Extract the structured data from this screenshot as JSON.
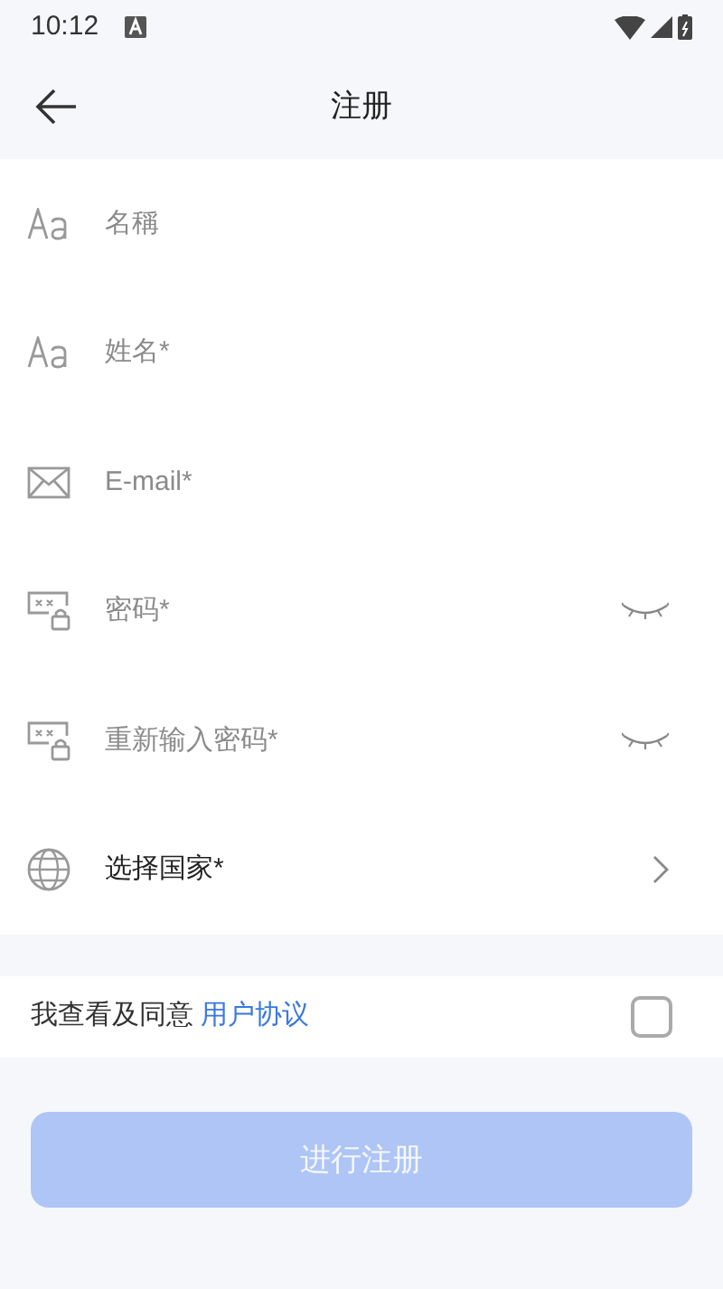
{
  "status_bar": {
    "time": "10:12"
  },
  "header": {
    "title": "注册"
  },
  "fields": [
    {
      "kind": "text",
      "placeholder": "名稱"
    },
    {
      "kind": "text",
      "placeholder": "姓名*"
    },
    {
      "kind": "email",
      "placeholder": "E-mail*"
    },
    {
      "kind": "password",
      "placeholder": "密码*"
    },
    {
      "kind": "password",
      "placeholder": "重新输入密码*"
    },
    {
      "kind": "select",
      "label": "选择国家*"
    }
  ],
  "agreement": {
    "text": "我查看及同意",
    "link": "用户协议",
    "checked": false
  },
  "submit": {
    "label": "进行注册",
    "disabled": true
  }
}
